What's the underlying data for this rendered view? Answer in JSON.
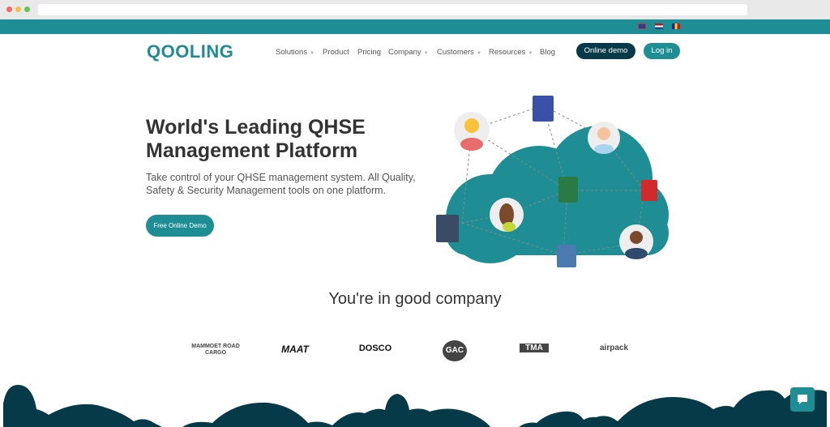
{
  "header": {
    "logo": "QOOLING",
    "flags": [
      "uk-flag-icon",
      "nl-flag-icon",
      "ro-flag-icon"
    ],
    "menu": [
      {
        "label": "Solutions",
        "dropdown": true
      },
      {
        "label": "Product",
        "dropdown": false
      },
      {
        "label": "Pricing",
        "dropdown": false
      },
      {
        "label": "Company",
        "dropdown": true
      },
      {
        "label": "Customers",
        "dropdown": true
      },
      {
        "label": "Resources",
        "dropdown": true
      },
      {
        "label": "Blog",
        "dropdown": false
      }
    ],
    "demo_button": "Online demo",
    "login_button": "Log in"
  },
  "hero": {
    "title": "World's Leading QHSE Management Platform",
    "subtitle": "Take control of your QHSE management system. All Quality, Safety & Security Management tools on one platform.",
    "cta": "Free Online Demo"
  },
  "customers": {
    "heading": "You're in good company",
    "logos": [
      "MAMMOET ROAD CARGO",
      "MAAT",
      "DOSCO",
      "GAC",
      "TMA",
      "airpack"
    ]
  },
  "colors": {
    "brand": "#1f8e94",
    "dark": "#063a48"
  }
}
